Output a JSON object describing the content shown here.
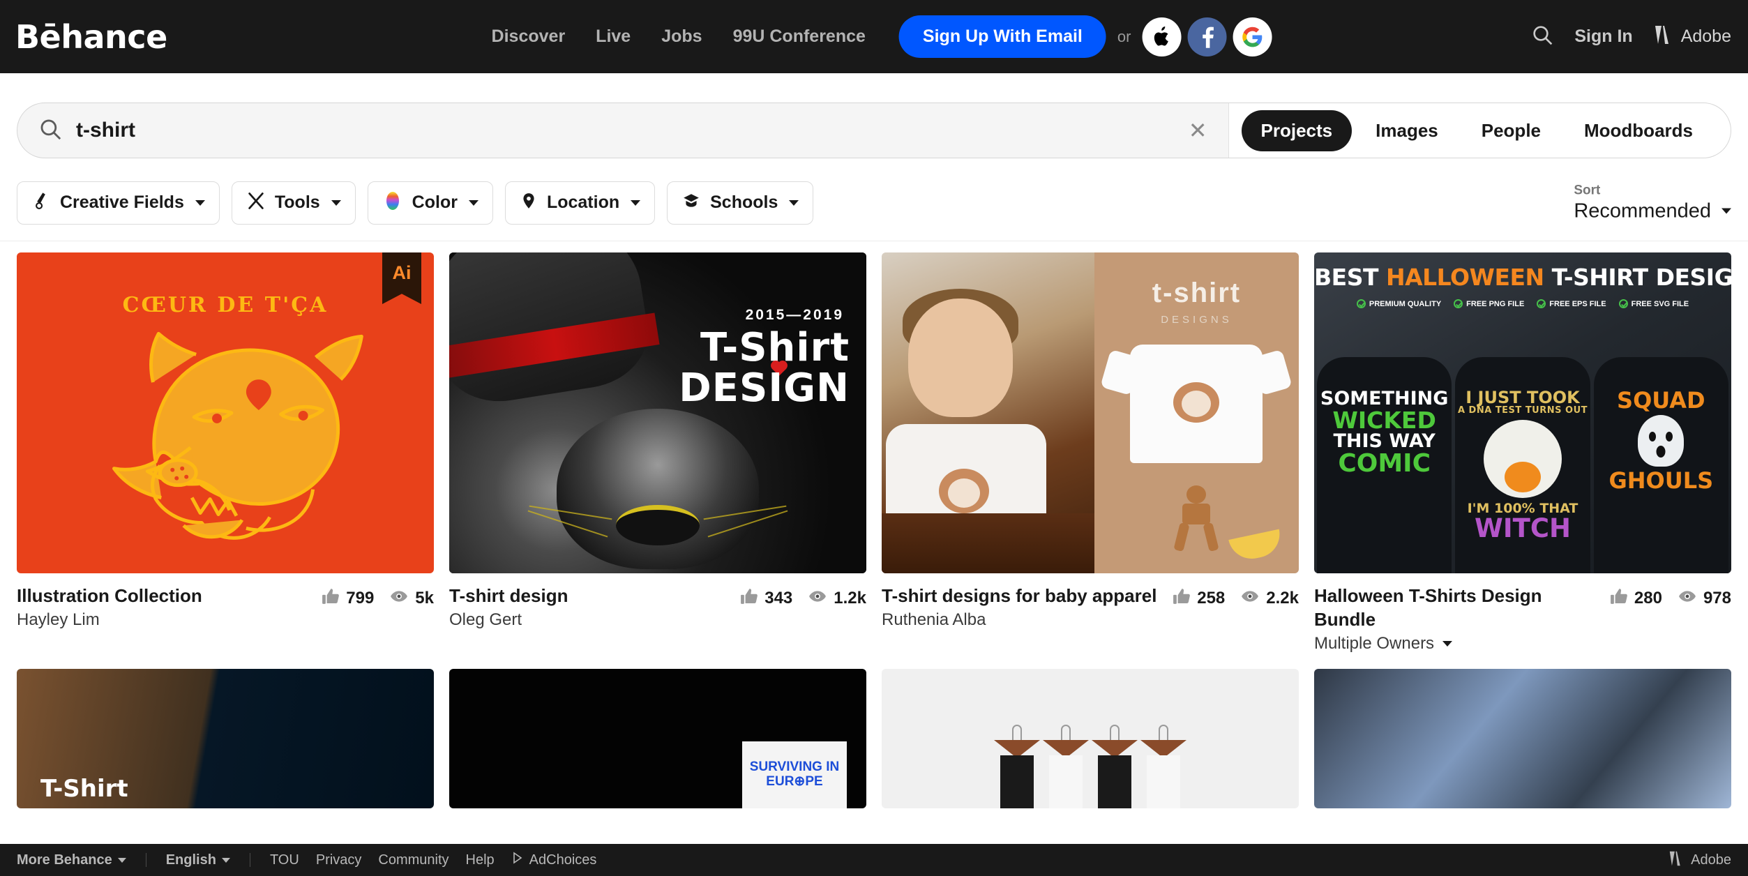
{
  "topnav": {
    "logo": "Bēhance",
    "links": [
      {
        "label": "Discover"
      },
      {
        "label": "Live"
      },
      {
        "label": "Jobs"
      },
      {
        "label": "99U Conference"
      }
    ],
    "signup_label": "Sign Up With Email",
    "or_text": "or",
    "social": [
      {
        "name": "apple-signin-icon"
      },
      {
        "name": "facebook-signin-icon"
      },
      {
        "name": "google-signin-icon"
      }
    ],
    "signin_label": "Sign In",
    "adobe_label": "Adobe",
    "bg_color": "#191919",
    "signup_color": "#0057ff"
  },
  "search": {
    "value": "t-shirt",
    "placeholder": "Search",
    "clear_label": "✕",
    "tabs": [
      {
        "label": "Projects",
        "active": true
      },
      {
        "label": "Images",
        "active": false
      },
      {
        "label": "People",
        "active": false
      },
      {
        "label": "Moodboards",
        "active": false
      }
    ]
  },
  "filters": [
    {
      "label": "Creative Fields",
      "icon": "pen-nib-icon"
    },
    {
      "label": "Tools",
      "icon": "tools-icon"
    },
    {
      "label": "Color",
      "icon": "color-wheel-icon"
    },
    {
      "label": "Location",
      "icon": "location-pin-icon"
    },
    {
      "label": "Schools",
      "icon": "graduation-cap-icon"
    }
  ],
  "sort": {
    "label": "Sort",
    "value": "Recommended"
  },
  "projects": [
    {
      "title": "Illustration Collection",
      "owner": "Hayley Lim",
      "likes": "799",
      "views": "5k",
      "multiple_owners": false,
      "badge": "Ai",
      "art": {
        "kind": "wolf",
        "bg_color": "#E8411A",
        "line_color": "#FDB913",
        "headline": "CŒUR DE T'ÇA"
      }
    },
    {
      "title": "T-shirt design",
      "owner": "Oleg Gert",
      "likes": "343",
      "views": "1.2k",
      "multiple_owners": false,
      "badge": null,
      "art": {
        "kind": "cat",
        "years": "2015—2019",
        "line1": "T-Shirt",
        "line2": "DESIGN",
        "accent_color": "#c81010"
      }
    },
    {
      "title": "T-shirt designs for baby apparel",
      "owner": "Ruthenia Alba",
      "likes": "258",
      "views": "2.2k",
      "multiple_owners": false,
      "badge": null,
      "art": {
        "kind": "baby",
        "mock_title": "t-shirt",
        "mock_sub": "DESIGNS",
        "panel_color": "#c49a76"
      }
    },
    {
      "title": "Halloween T-Shirts Design Bundle",
      "owner": "Multiple Owners",
      "likes": "280",
      "views": "978",
      "multiple_owners": true,
      "badge": null,
      "art": {
        "kind": "halloween",
        "title_a": "BEST ",
        "title_b": "HALLOWEEN",
        "title_c": " T-SHIRT DESIGN",
        "badges": [
          "PREMIUM QUALITY",
          "FREE PNG FILE",
          "FREE EPS FILE",
          "FREE SVG FILE"
        ],
        "accent_color": "#F5871F",
        "check_color": "#46c24a",
        "shirts": [
          {
            "lines": [
              {
                "text": "SOMETHING",
                "color": "#ffffff",
                "size": 27
              },
              {
                "text": "WICKED",
                "color": "#4ec93b",
                "size": 33
              },
              {
                "text": "THIS WAY",
                "color": "#ffffff",
                "size": 27
              },
              {
                "text": "COMIC",
                "color": "#4ec93b",
                "size": 36
              }
            ]
          },
          {
            "lines": [
              {
                "text": "I JUST TOOK",
                "color": "#e0c060",
                "size": 24
              },
              {
                "text": "A DNA TEST TURNS OUT",
                "color": "#e0c060",
                "size": 13
              }
            ],
            "lines_after": [
              {
                "text": "I'M 100% THAT",
                "color": "#e0c060",
                "size": 19
              },
              {
                "text": "WITCH",
                "color": "#b455c9",
                "size": 37
              }
            ]
          },
          {
            "lines": [
              {
                "text": "SQUAD",
                "color": "#f08b1d",
                "size": 32
              }
            ],
            "lines_after": [
              {
                "text": "GHOULS",
                "color": "#f08b1d",
                "size": 32
              }
            ]
          }
        ]
      }
    }
  ],
  "projects_bottom": [
    {
      "art": "wood-dark-tshirt",
      "label": "T-Shirt"
    },
    {
      "art": "surviving-europe",
      "sign": "SURVIVING IN EUR⊕PE"
    },
    {
      "art": "hanging-shirts"
    },
    {
      "art": "blue-abstract"
    }
  ],
  "footer": {
    "more_behance": "More Behance",
    "language": "English",
    "links": [
      {
        "label": "TOU"
      },
      {
        "label": "Privacy"
      },
      {
        "label": "Community"
      },
      {
        "label": "Help"
      }
    ],
    "adchoices": "AdChoices",
    "adobe_label": "Adobe"
  }
}
